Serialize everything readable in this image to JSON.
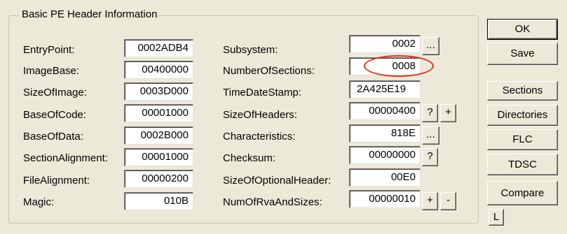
{
  "group": {
    "title": "Basic PE Header Information"
  },
  "left_fields": [
    {
      "label": "EntryPoint:",
      "value": "0002ADB4"
    },
    {
      "label": "ImageBase:",
      "value": "00400000"
    },
    {
      "label": "SizeOfImage:",
      "value": "0003D000"
    },
    {
      "label": "BaseOfCode:",
      "value": "00001000"
    },
    {
      "label": "BaseOfData:",
      "value": "0002B000"
    },
    {
      "label": "SectionAlignment:",
      "value": "00001000"
    },
    {
      "label": "FileAlignment:",
      "value": "00000200"
    },
    {
      "label": "Magic:",
      "value": "010B"
    }
  ],
  "right_fields": [
    {
      "label": "Subsystem:",
      "value": "0002"
    },
    {
      "label": "NumberOfSections:",
      "value": "0008"
    },
    {
      "label": "TimeDateStamp:",
      "value": "2A425E19"
    },
    {
      "label": "SizeOfHeaders:",
      "value": "00000400"
    },
    {
      "label": "Characteristics:",
      "value": "818E"
    },
    {
      "label": "Checksum:",
      "value": "00000000"
    },
    {
      "label": "SizeOfOptionalHeader:",
      "value": "00E0"
    },
    {
      "label": "NumOfRvaAndSizes:",
      "value": "00000010"
    }
  ],
  "small_buttons": {
    "subsystem_more": "...",
    "headers_help": "?",
    "headers_plus": "+",
    "characteristics_more": "...",
    "checksum_help": "?",
    "rva_plus": "+",
    "rva_minus": "-"
  },
  "side_buttons": {
    "ok": "OK",
    "save": "Save",
    "sections": "Sections",
    "directories": "Directories",
    "flc": "FLC",
    "tdsc": "TDSC",
    "compare": "Compare",
    "l": "L"
  },
  "highlight_color": "#e8311e",
  "window_bg": "#ece9d8"
}
